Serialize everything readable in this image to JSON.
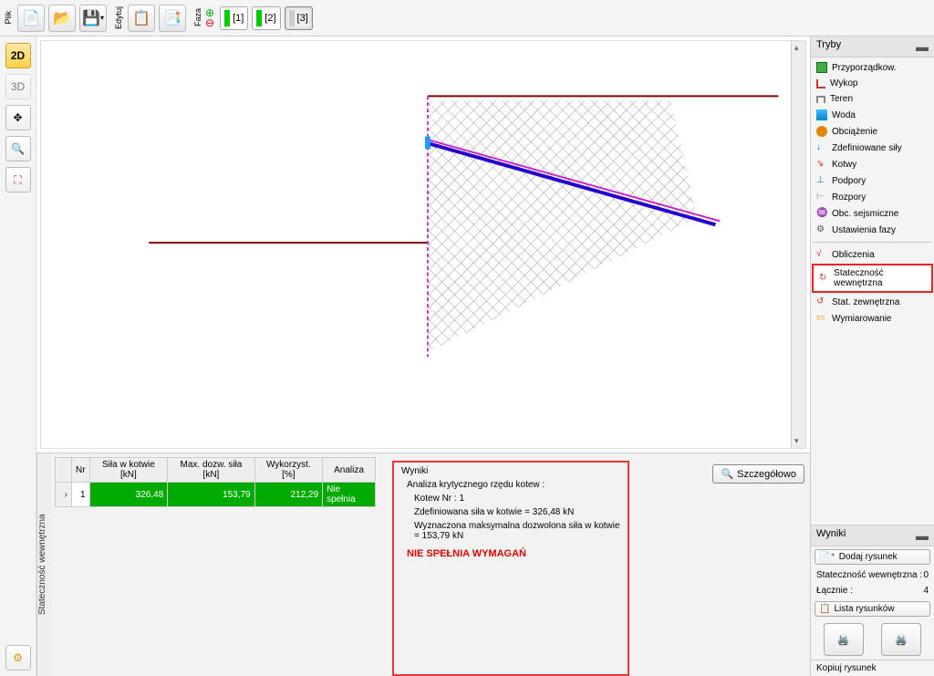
{
  "toolbar": {
    "file_label": "Plik",
    "edit_label": "Edytuj",
    "phase_label": "Faza",
    "phases": [
      "[1]",
      "[2]",
      "[3]"
    ]
  },
  "left_tools": {
    "view2d": "2D",
    "view3d": "3D"
  },
  "modes": {
    "panel_title": "Tryby",
    "items": [
      "Przyporządkow.",
      "Wykop",
      "Teren",
      "Woda",
      "Obciążenie",
      "Zdefiniowane siły",
      "Kotwy",
      "Podpory",
      "Rozpory",
      "Obc. sejsmiczne",
      "Ustawienia fazy"
    ],
    "results_items": [
      "Obliczenia",
      "Stateczność wewnętrzna",
      "Stat. zewnętrzna",
      "Wymiarowanie"
    ]
  },
  "table": {
    "headers": {
      "nr": "Nr",
      "sila": "Siła w kotwie\n[kN]",
      "max": "Max. dozw. siła\n[kN]",
      "wyk": "Wykorzyst.\n[%]",
      "analiza": "Analiza"
    },
    "row": {
      "nr": "1",
      "sila": "326,48",
      "max": "153,79",
      "wyk": "212,29",
      "analiza": "Nie spełnia"
    }
  },
  "results": {
    "title": "Wyniki",
    "l1": "Analiza krytycznego rzędu kotew :",
    "l2": "Kotew Nr : 1",
    "l3": "Zdefiniowana siła w kotwie = 326,48 kN",
    "l4": "Wyznaczona maksymalna dozwolona siła w kotwie = 153,79 kN",
    "fail": "NIE SPEŁNIA WYMAGAŃ",
    "detail_btn": "Szczegółowo"
  },
  "bottom_right": {
    "title": "Wyniki",
    "add": "Dodaj rysunek",
    "stat_label": "Stateczność wewnętrzna :",
    "stat_val": "0",
    "total_label": "Łącznie :",
    "total_val": "4",
    "list": "Lista rysunków",
    "copy": "Kopiuj rysunek"
  },
  "vlabel": "Stateczność wewnętrzna"
}
